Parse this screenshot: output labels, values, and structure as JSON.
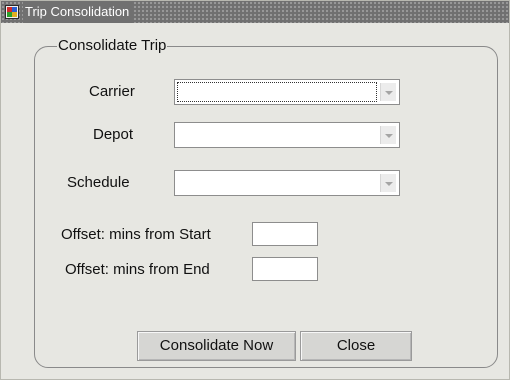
{
  "window": {
    "title": "Trip Consolidation",
    "app_icon": "oracle-forms-window-icon"
  },
  "group": {
    "title": "Consolidate Trip"
  },
  "fields": {
    "carrier": {
      "label": "Carrier",
      "value": ""
    },
    "depot": {
      "label": "Depot",
      "value": ""
    },
    "schedule": {
      "label": "Schedule",
      "value": ""
    },
    "offset_start": {
      "label": "Offset: mins from Start",
      "value": ""
    },
    "offset_end": {
      "label": "Offset: mins from End",
      "value": ""
    }
  },
  "buttons": {
    "consolidate": "Consolidate Now",
    "close": "Close"
  },
  "colors": {
    "window_background": "#e7e7e2",
    "titlebar": "#707070"
  }
}
